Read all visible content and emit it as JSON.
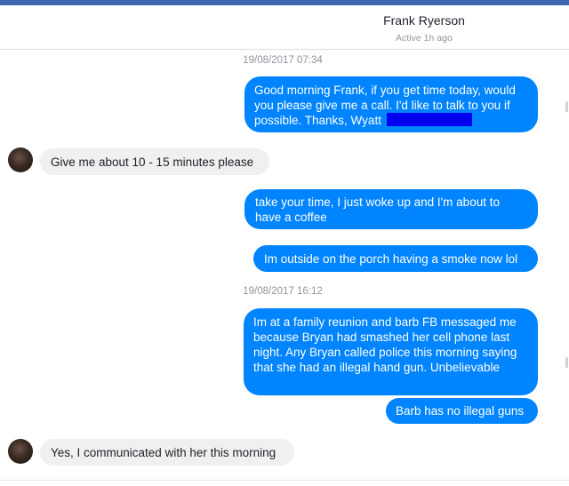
{
  "header": {
    "contact_name": "Frank Ryerson",
    "status": "Active 1h ago"
  },
  "colors": {
    "outgoing_bubble": "#0084ff",
    "incoming_bubble": "#f1f0f0",
    "top_bar": "#4267b2",
    "redaction": "#0000ee"
  },
  "messages": [
    {
      "type": "timestamp",
      "text": "19/08/2017 07:34"
    },
    {
      "type": "outgoing",
      "text": "Good morning Frank, if you get time today, would you please give me a call. I'd like to talk to you if possible. Thanks, Wyatt"
    },
    {
      "type": "incoming",
      "text": "Give me about 10 - 15 minutes please"
    },
    {
      "type": "outgoing",
      "text": "take your time, I just woke up and I'm about to have a coffee"
    },
    {
      "type": "outgoing",
      "text": "Im outside on the porch having a smoke now lol"
    },
    {
      "type": "timestamp",
      "text": "19/08/2017 16:12"
    },
    {
      "type": "outgoing",
      "text": "Im at a family reunion and barb FB messaged me because Bryan had smashed her cell phone last night. Any Bryan called police this morning saying that she had an illegal hand gun. Unbelievable"
    },
    {
      "type": "outgoing",
      "text": "Barb has no illegal guns"
    },
    {
      "type": "incoming",
      "text": "Yes, I communicated with her this morning"
    }
  ]
}
